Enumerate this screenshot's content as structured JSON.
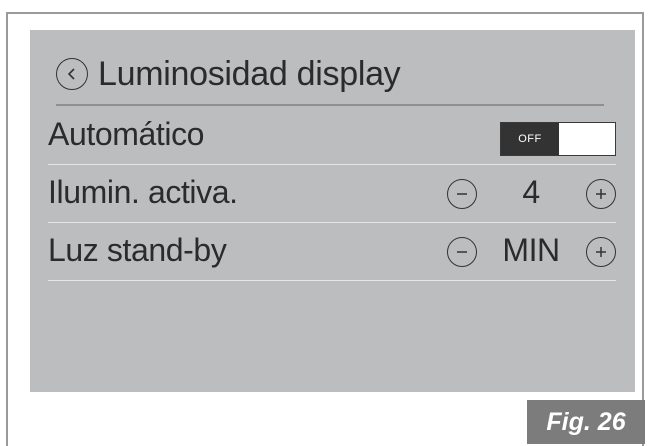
{
  "header": {
    "title": "Luminosidad display",
    "back_icon": "chevron-left-icon"
  },
  "rows": [
    {
      "label": "Automático",
      "control": "toggle",
      "toggle_state": "OFF"
    },
    {
      "label": "Ilumin. activa.",
      "control": "stepper",
      "value": "4"
    },
    {
      "label": "Luz stand-by",
      "control": "stepper",
      "value": "MIN"
    }
  ],
  "figure": {
    "caption": "Fig. 26"
  },
  "colors": {
    "screen_bg": "#bcbdbf",
    "text": "#2b2b2b",
    "toggle_off_bg": "#333333",
    "fig_bg": "#7c7c7d"
  }
}
